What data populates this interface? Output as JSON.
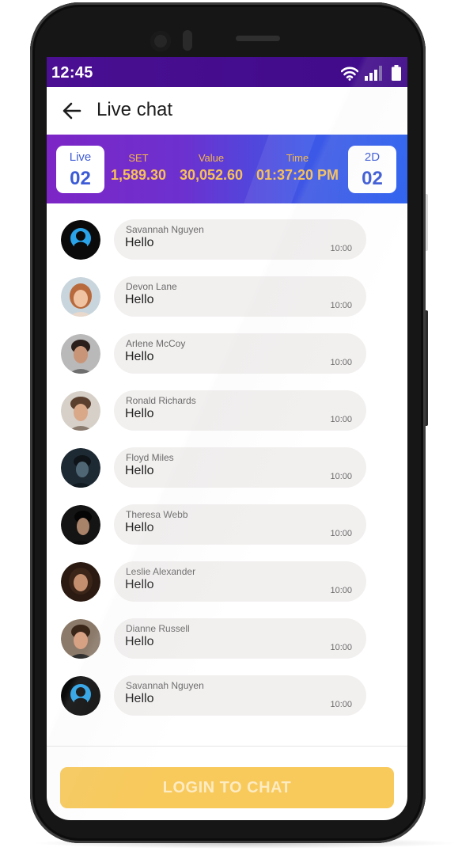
{
  "status_bar": {
    "time": "12:45",
    "icons": [
      "wifi-icon",
      "signal-icon",
      "battery-icon"
    ]
  },
  "header": {
    "title": "Live chat",
    "back_icon": "arrow-left-icon"
  },
  "results_banner": {
    "live_badge": {
      "label": "Live",
      "value": "02"
    },
    "set": {
      "label": "SET",
      "value": "1,589.30"
    },
    "value": {
      "label": "Value",
      "value": "30,052.60"
    },
    "time": {
      "label": "Time",
      "value": "01:37:20 PM"
    },
    "twod_badge": {
      "label": "2D",
      "value": "02"
    },
    "colors": {
      "gradient_start": "#7d25c6",
      "gradient_end": "#2f63f0",
      "stat_text": "#f6c05a",
      "badge_text": "#3d5bd6"
    }
  },
  "messages": [
    {
      "name": "Savannah Nguyen",
      "text": "Hello",
      "time": "10:00",
      "avatar": "default-user-icon"
    },
    {
      "name": "Devon Lane",
      "text": "Hello",
      "time": "10:00",
      "avatar": "photo"
    },
    {
      "name": "Arlene McCoy",
      "text": "Hello",
      "time": "10:00",
      "avatar": "photo"
    },
    {
      "name": "Ronald Richards",
      "text": "Hello",
      "time": "10:00",
      "avatar": "photo"
    },
    {
      "name": "Floyd Miles",
      "text": "Hello",
      "time": "10:00",
      "avatar": "photo"
    },
    {
      "name": "Theresa Webb",
      "text": "Hello",
      "time": "10:00",
      "avatar": "photo"
    },
    {
      "name": "Leslie Alexander",
      "text": "Hello",
      "time": "10:00",
      "avatar": "photo"
    },
    {
      "name": "Dianne Russell",
      "text": "Hello",
      "time": "10:00",
      "avatar": "photo"
    },
    {
      "name": "Savannah Nguyen",
      "text": "Hello",
      "time": "10:00",
      "avatar": "default-user-icon"
    }
  ],
  "login_button": {
    "label": "LOGIN TO CHAT",
    "color": "#f8c95b"
  }
}
